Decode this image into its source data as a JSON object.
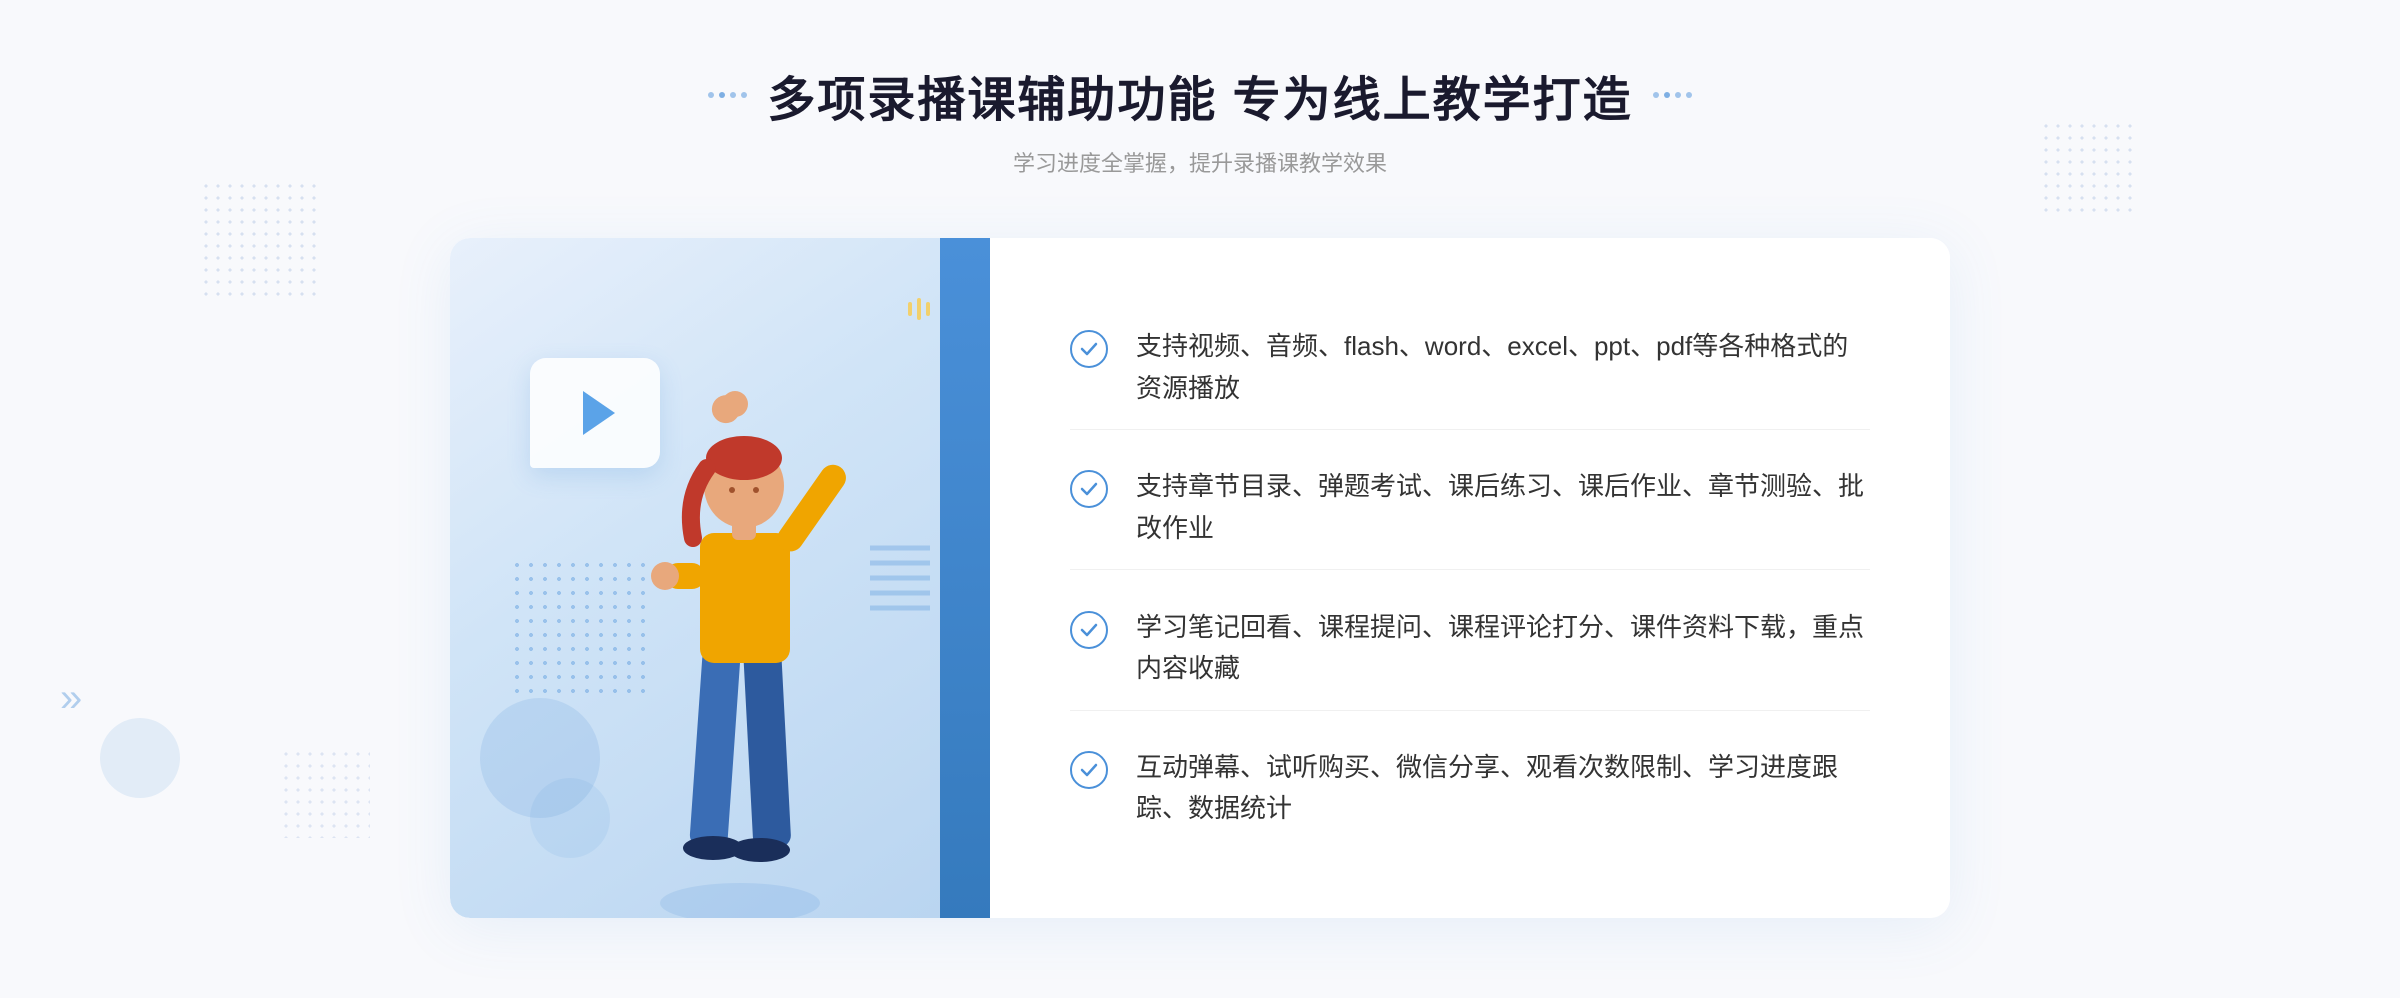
{
  "page": {
    "background_color": "#f8f9fc"
  },
  "header": {
    "main_title": "多项录播课辅助功能 专为线上教学打造",
    "sub_title": "学习进度全掌握，提升录播课教学效果"
  },
  "features": [
    {
      "id": 1,
      "text": "支持视频、音频、flash、word、excel、ppt、pdf等各种格式的资源播放"
    },
    {
      "id": 2,
      "text": "支持章节目录、弹题考试、课后练习、课后作业、章节测验、批改作业"
    },
    {
      "id": 3,
      "text": "学习笔记回看、课程提问、课程评论打分、课件资料下载，重点内容收藏"
    },
    {
      "id": 4,
      "text": "互动弹幕、试听购买、微信分享、观看次数限制、学习进度跟踪、数据统计"
    }
  ],
  "icons": {
    "check": "✓",
    "chevron_left": "»",
    "chevron_right": "«"
  },
  "colors": {
    "primary": "#4a90d9",
    "title": "#1a1a2e",
    "text": "#333333",
    "subtext": "#999999",
    "border": "#f0f0f0"
  }
}
